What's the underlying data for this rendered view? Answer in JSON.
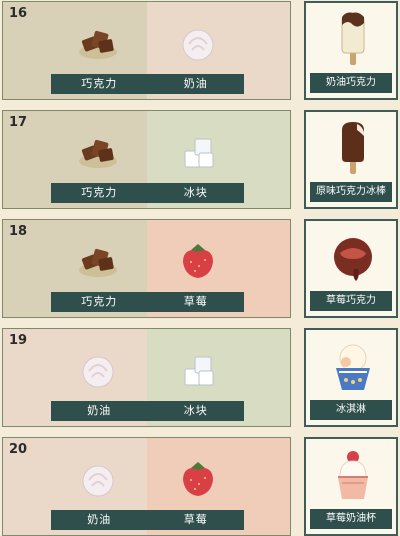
{
  "recipes": [
    {
      "number": "16",
      "ingredient_a": {
        "label": "巧克力",
        "icon": "chocolate-icon",
        "bg": "#d9d1b7"
      },
      "ingredient_b": {
        "label": "奶油",
        "icon": "cream-icon",
        "bg": "#ead9c9"
      },
      "result": {
        "label": "奶油巧克力",
        "icon": "cream-chocolate-popsicle-icon"
      }
    },
    {
      "number": "17",
      "ingredient_a": {
        "label": "巧克力",
        "icon": "chocolate-icon",
        "bg": "#d9d1b7"
      },
      "ingredient_b": {
        "label": "冰块",
        "icon": "ice-cube-icon",
        "bg": "#d7dcc2"
      },
      "result": {
        "label": "原味巧克力冰棒",
        "icon": "chocolate-popsicle-icon"
      }
    },
    {
      "number": "18",
      "ingredient_a": {
        "label": "巧克力",
        "icon": "chocolate-icon",
        "bg": "#d9d1b7"
      },
      "ingredient_b": {
        "label": "草莓",
        "icon": "strawberry-icon",
        "bg": "#efcdb9"
      },
      "result": {
        "label": "草莓巧克力",
        "icon": "strawberry-chocolate-icon"
      }
    },
    {
      "number": "19",
      "ingredient_a": {
        "label": "奶油",
        "icon": "cream-icon",
        "bg": "#ead9c9"
      },
      "ingredient_b": {
        "label": "冰块",
        "icon": "ice-cube-icon",
        "bg": "#d7dcc2"
      },
      "result": {
        "label": "冰淇淋",
        "icon": "ice-cream-cup-icon"
      }
    },
    {
      "number": "20",
      "ingredient_a": {
        "label": "奶油",
        "icon": "cream-icon",
        "bg": "#ead9c9"
      },
      "ingredient_b": {
        "label": "草莓",
        "icon": "strawberry-icon",
        "bg": "#efcdb9"
      },
      "result": {
        "label": "草莓奶油杯",
        "icon": "strawberry-cream-cup-icon"
      }
    }
  ]
}
